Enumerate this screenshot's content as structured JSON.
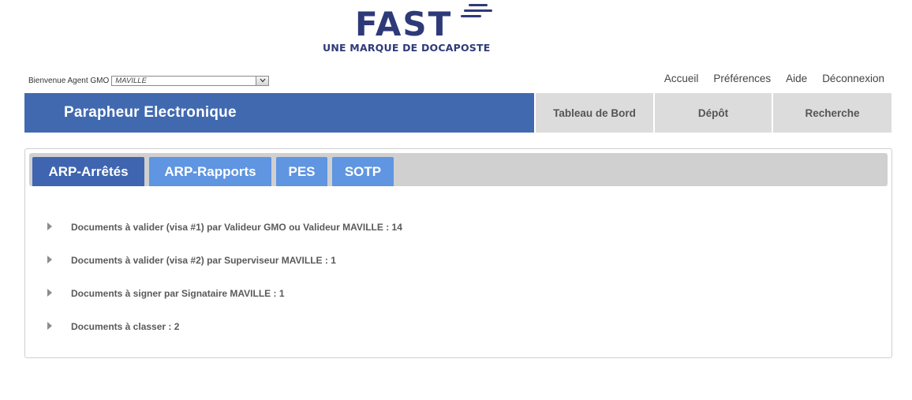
{
  "colors": {
    "brand_navy": "#2e3a78",
    "header_blue": "#4169b0",
    "tab_active": "#3f65b0",
    "tab_inactive": "#5f95e1",
    "nav_gray": "#dcdcdc"
  },
  "logo": {
    "name": "FAST",
    "tagline": "UNE MARQUE DE DOCAPOSTE"
  },
  "user_bar": {
    "welcome_label": "Bienvenue Agent GMO",
    "organization_value": "MAVILLE",
    "dropdown_icon": "chevron-down-icon"
  },
  "top_links": [
    {
      "label": "Accueil"
    },
    {
      "label": "Préférences"
    },
    {
      "label": "Aide"
    },
    {
      "label": "Déconnexion"
    }
  ],
  "header": {
    "title": "Parapheur Electronique",
    "nav": [
      {
        "label": "Tableau de Bord"
      },
      {
        "label": "Dépôt"
      },
      {
        "label": "Recherche"
      }
    ]
  },
  "tabs": [
    {
      "label": "ARP-Arrêtés",
      "active": true
    },
    {
      "label": "ARP-Rapports",
      "active": false
    },
    {
      "label": "PES",
      "active": false
    },
    {
      "label": "SOTP",
      "active": false
    }
  ],
  "documents": [
    {
      "label": "Documents à valider (visa #1) par Valideur GMO ou Valideur MAVILLE : 14"
    },
    {
      "label": "Documents à valider (visa #2) par Superviseur MAVILLE : 1"
    },
    {
      "label": "Documents à signer par Signataire MAVILLE : 1"
    },
    {
      "label": "Documents à classer : 2"
    }
  ]
}
